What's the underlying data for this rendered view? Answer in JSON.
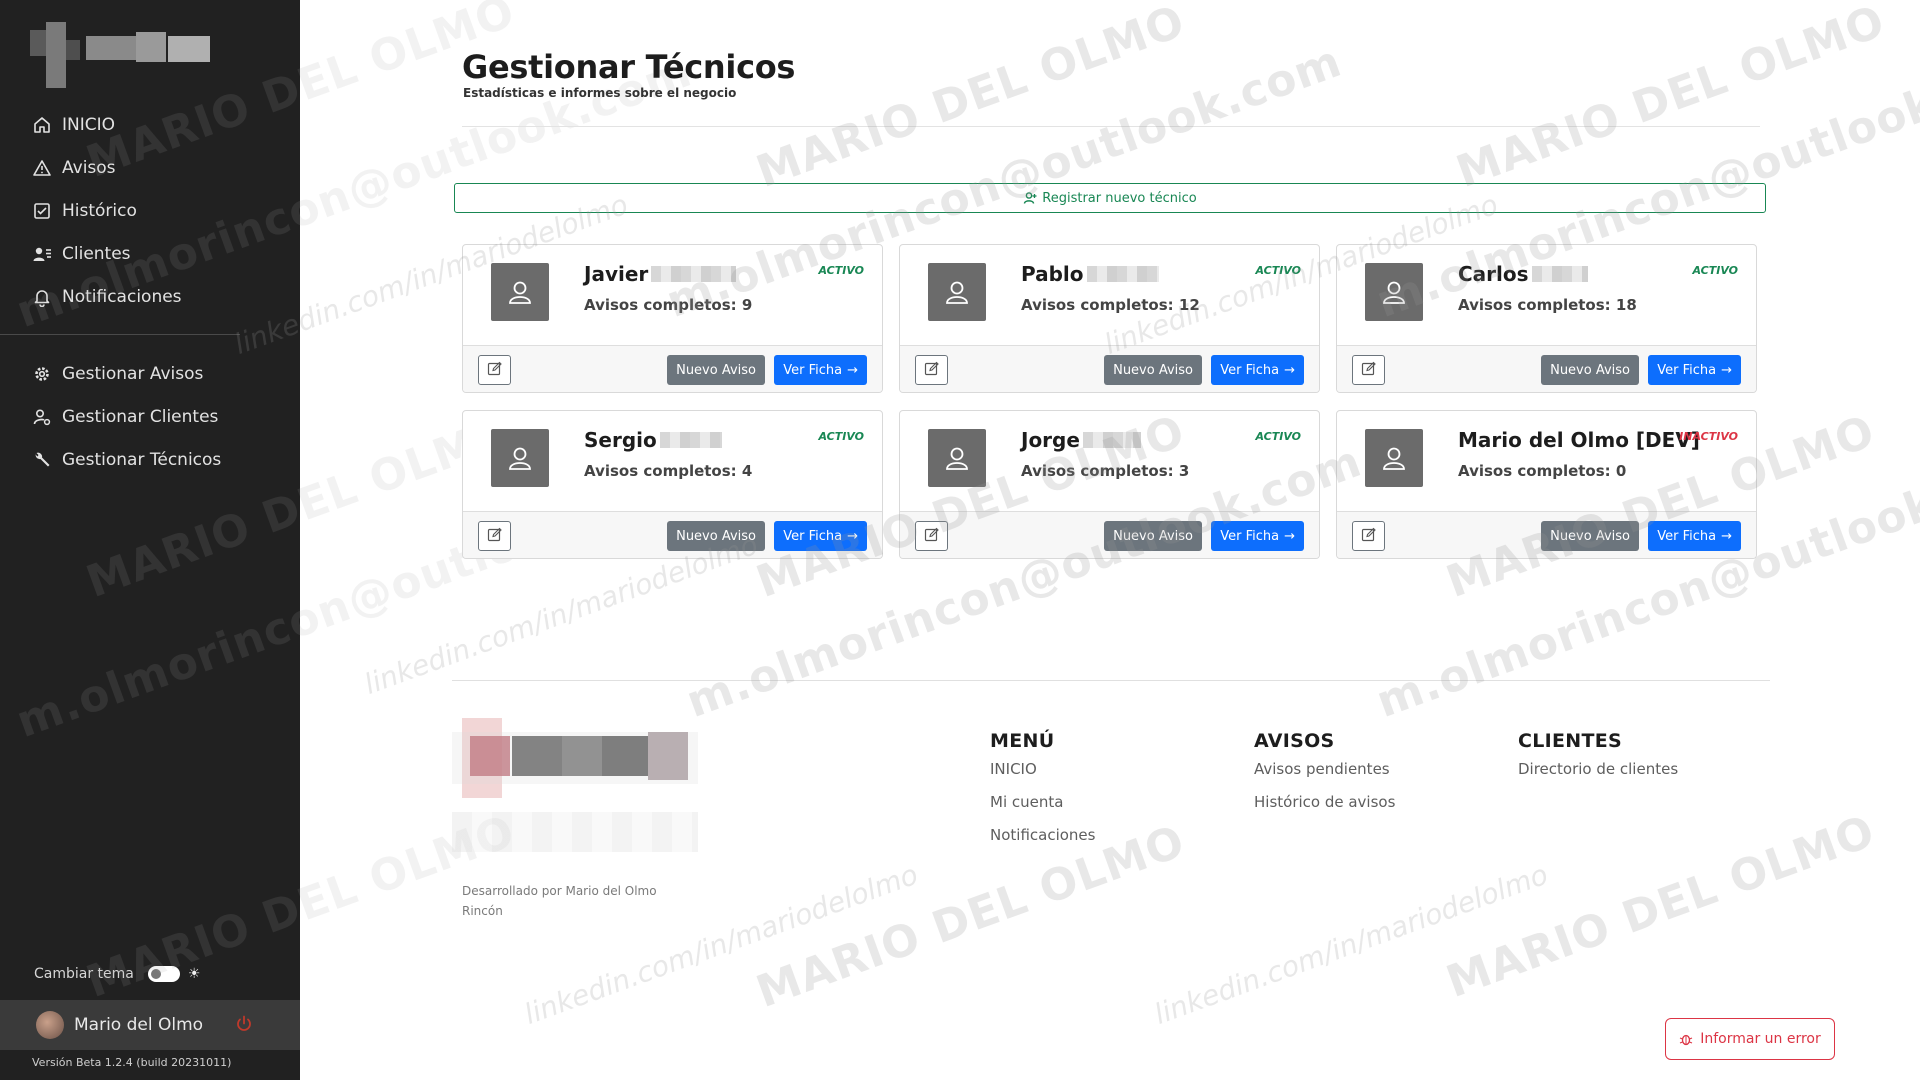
{
  "sidebar": {
    "nav_main": [
      {
        "label": "INICIO",
        "icon": "home-icon"
      },
      {
        "label": "Avisos",
        "icon": "warning-icon"
      },
      {
        "label": "Histórico",
        "icon": "history-icon"
      },
      {
        "label": "Clientes",
        "icon": "clients-icon"
      },
      {
        "label": "Notificaciones",
        "icon": "bell-icon"
      }
    ],
    "nav_admin": [
      {
        "label": "Gestionar Avisos",
        "icon": "gear-icon"
      },
      {
        "label": "Gestionar Clientes",
        "icon": "user-manage-icon"
      },
      {
        "label": "Gestionar Técnicos",
        "icon": "wrench-icon"
      }
    ],
    "theme_label": "Cambiar tema",
    "user_name": "Mario del Olmo",
    "version": "Versión Beta 1.2.4 (build 20231011)"
  },
  "page": {
    "title": "Gestionar Técnicos",
    "subtitle": "Estadísticas e informes sobre el negocio",
    "register_label": "Registrar nuevo técnico"
  },
  "technicians": [
    {
      "name": "Javier",
      "completed": "Avisos completos: 9",
      "status": "ACTIVO",
      "active": true
    },
    {
      "name": "Pablo",
      "completed": "Avisos completos: 12",
      "status": "ACTIVO",
      "active": true
    },
    {
      "name": "Carlos",
      "completed": "Avisos completos: 18",
      "status": "ACTIVO",
      "active": true
    },
    {
      "name": "Sergio",
      "completed": "Avisos completos: 4",
      "status": "ACTIVO",
      "active": true
    },
    {
      "name": "Jorge",
      "completed": "Avisos completos: 3",
      "status": "ACTIVO",
      "active": true
    },
    {
      "name": "Mario del Olmo [DEV]",
      "completed": "Avisos completos: 0",
      "status": "INACTIVO",
      "active": false
    }
  ],
  "card_actions": {
    "new_label": "Nuevo Aviso",
    "view_label": "Ver Ficha"
  },
  "footer": {
    "developer": "Desarrollado por Mario del Olmo Rincón",
    "menu": {
      "heading": "MENÚ",
      "links": [
        "INICIO",
        "Mi cuenta",
        "Notificaciones"
      ]
    },
    "avisos": {
      "heading": "AVISOS",
      "links": [
        "Avisos pendientes",
        "Histórico de avisos"
      ]
    },
    "clientes": {
      "heading": "CLIENTES",
      "links": [
        "Directorio de clientes"
      ]
    },
    "report_label": "Informar un error"
  },
  "watermark": {
    "line1": "MARIO DEL OLMO",
    "line2": "m.olmorincon@outlook.com",
    "line3": "linkedin.com/in/mariodelolmo"
  },
  "colors": {
    "sidebar_bg": "#212121",
    "active_status": "#198754",
    "inactive_status": "#dc3545",
    "primary": "#0d6efd",
    "secondary": "#6c757d"
  }
}
